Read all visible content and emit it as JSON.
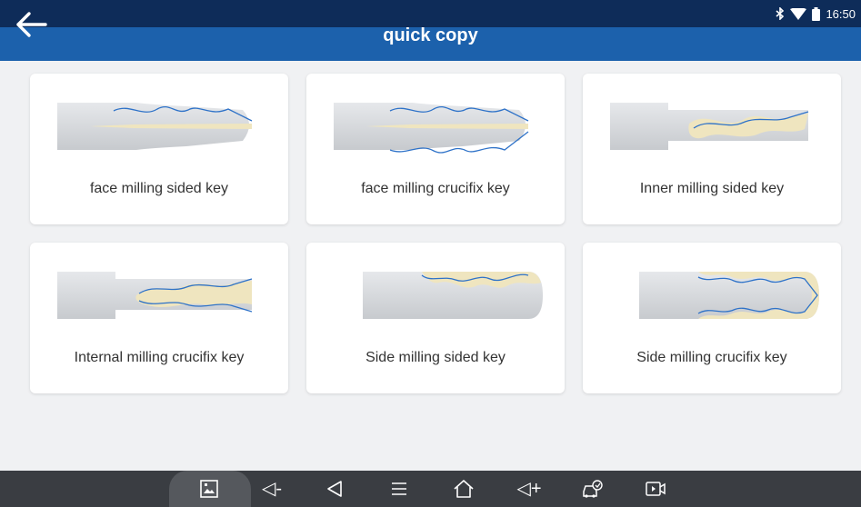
{
  "status": {
    "time": "16:50",
    "icons": [
      "bluetooth-icon",
      "wifi-icon",
      "battery-icon"
    ]
  },
  "header": {
    "title": "quick copy",
    "back_icon": "arrow-left-icon"
  },
  "cards": [
    {
      "label": "face milling sided key",
      "icon": "face-milling-sided-key-icon"
    },
    {
      "label": "face milling crucifix key",
      "icon": "face-milling-crucifix-key-icon"
    },
    {
      "label": "Inner milling sided key",
      "icon": "inner-milling-sided-key-icon"
    },
    {
      "label": "Internal milling crucifix key",
      "icon": "internal-milling-crucifix-key-icon"
    },
    {
      "label": "Side milling sided key",
      "icon": "side-milling-sided-key-icon"
    },
    {
      "label": "Side milling crucifix key",
      "icon": "side-milling-crucifix-key-icon"
    }
  ],
  "navbar": {
    "vol_down": "◁-",
    "vol_up": "◁+",
    "icons": [
      "screenshot-icon",
      "volume-down-icon",
      "back-icon",
      "menu-icon",
      "home-icon",
      "volume-up-icon",
      "vehicle-diagnostic-icon",
      "screen-record-icon"
    ]
  },
  "colors": {
    "header": "#1c61ac",
    "status_bar": "#0e2c59",
    "background": "#f0f1f3",
    "key_cut": "#efe5bf",
    "key_line": "#2e72c8",
    "nav_bar": "#3a3d42"
  }
}
